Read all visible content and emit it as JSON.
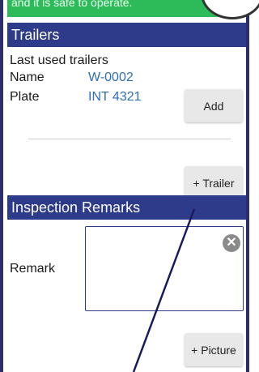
{
  "status": {
    "text": "and it is safe to operate."
  },
  "trailers": {
    "header": "Trailers",
    "last_used_label": "Last used trailers",
    "name_label": "Name",
    "name_value": "W-0002",
    "plate_label": "Plate",
    "plate_value": "INT 4321",
    "add_button": "Add",
    "add_trailer_button": "+ Trailer"
  },
  "inspection": {
    "header": "Inspection Remarks",
    "remark_label": "Remark",
    "remark_value": "",
    "add_picture_button": "+ Picture"
  },
  "icons": {
    "clear": "clear-icon"
  },
  "colors": {
    "header_bg": "#2e3a8a",
    "banner_bg": "#2dbb5a",
    "link": "#2f6fb3",
    "frame": "#2d2d6b"
  }
}
